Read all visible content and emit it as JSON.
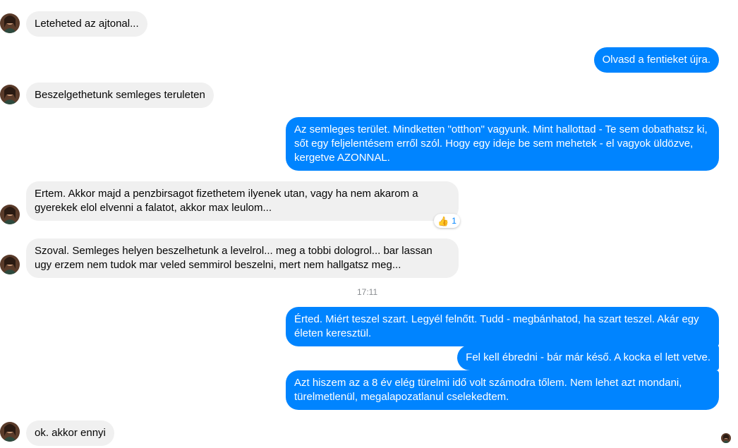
{
  "conversation": {
    "timestamp": "17:11",
    "messages": [
      {
        "sender": "them",
        "text": "Leteheted az ajtonal..."
      },
      {
        "sender": "me",
        "text": "Olvasd a fentieket újra."
      },
      {
        "sender": "them",
        "text": "Beszelgethetunk semleges teruleten"
      },
      {
        "sender": "me",
        "text": "Az semleges terület. Mindketten \"otthon\" vagyunk. Mint hallottad - Te sem dobathatsz ki, sőt egy feljelentésem erről szól. Hogy egy ideje be sem mehetek - el vagyok üldözve, kergetve AZONNAL."
      },
      {
        "sender": "them",
        "text": "Ertem. Akkor majd a penzbirsagot fizethetem ilyenek utan, vagy ha nem akarom a gyerekek elol elvenni a falatot, akkor max leulom..."
      },
      {
        "sender": "them",
        "text": "Szoval. Semleges helyen beszelhetunk a levelrol... meg a tobbi dologrol... bar lassan ugy erzem nem tudok mar veled semmirol beszelni, mert nem hallgatsz meg..."
      },
      {
        "sender": "me",
        "text": "Érted. Miért teszel szart. Legyél felnőtt. Tudd - megbánhatod, ha szart teszel. Akár egy életen keresztül."
      },
      {
        "sender": "me",
        "text": "Fel kell ébredni - bár már késő. A kocka el lett vetve."
      },
      {
        "sender": "me",
        "text": "Azt hiszem az a 8 év elég türelmi idő volt számodra tőlem. Nem lehet azt mondani, türelmetlenül, megalapozatlanul cselekedtem."
      },
      {
        "sender": "them",
        "text": "ok. akkor ennyi"
      }
    ],
    "reaction": {
      "emoji": "👍",
      "count": "1"
    }
  },
  "icons": {
    "contact_avatar": "contact-avatar-icon",
    "seen_avatar": "seen-receipt-avatar-icon",
    "reaction": "thumbs-up-icon"
  },
  "colors": {
    "outgoing_bubble": "#0084ff",
    "incoming_bubble": "#f0f0f0",
    "timestamp_text": "#8a8d91"
  }
}
